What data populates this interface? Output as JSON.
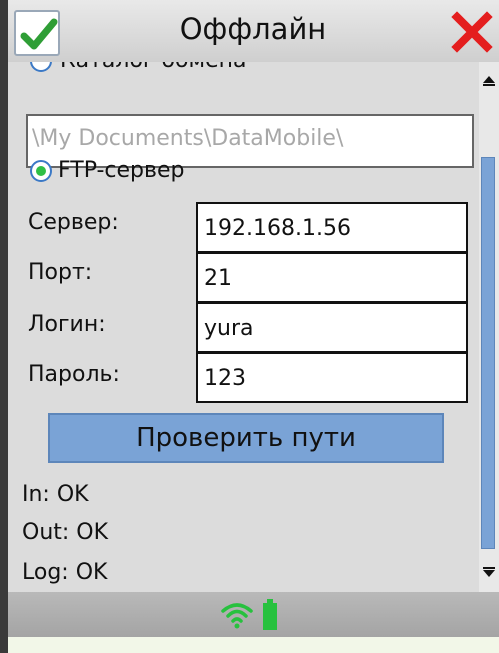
{
  "window": {
    "title": "Оффлайн",
    "ok_icon": "checkmark-icon",
    "close_icon": "close-x-icon"
  },
  "exchange": {
    "catalog_option_label": "Каталог обмена",
    "catalog_path": "\\My Documents\\DataMobile\\",
    "ftp_option_label": "FTP-сервер",
    "selected_option": "FTP-сервер"
  },
  "ftp": {
    "server_label": "Сервер:",
    "server_value": "192.168.1.56",
    "port_label": "Порт:",
    "port_value": "21",
    "login_label": "Логин:",
    "login_value": "yura",
    "password_label": "Пароль:",
    "password_value": "123"
  },
  "actions": {
    "check_paths_label": "Проверить пути"
  },
  "status": {
    "in": "In: OK",
    "out": "Out: OK",
    "log": "Log: OK"
  },
  "statusbar": {
    "icons": [
      "wifi-icon",
      "battery-icon"
    ],
    "accent_color": "#27c13e"
  },
  "colors": {
    "button_fill": "#7aa3d6",
    "radio_selected": "#2fbf46",
    "close_x": "#e41e1e"
  }
}
